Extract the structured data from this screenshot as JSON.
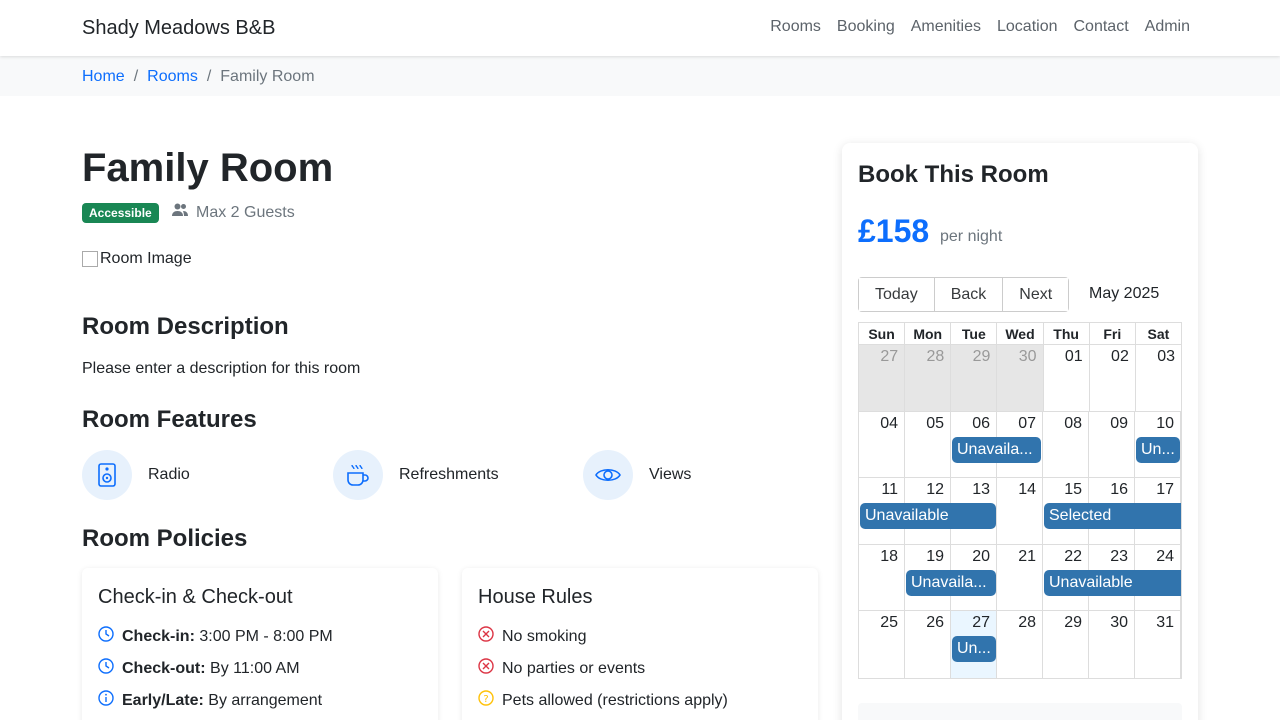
{
  "nav": {
    "brand": "Shady Meadows B&B",
    "links": [
      "Rooms",
      "Booking",
      "Amenities",
      "Location",
      "Contact",
      "Admin"
    ]
  },
  "breadcrumb": {
    "home": "Home",
    "rooms": "Rooms",
    "current": "Family Room"
  },
  "room": {
    "title": "Family Room",
    "badge": "Accessible",
    "guests": "Max 2 Guests",
    "image_alt": "Room Image",
    "description_heading": "Room Description",
    "description": "Please enter a description for this room",
    "features_heading": "Room Features",
    "features": [
      {
        "label": "Radio",
        "icon": "speaker-icon"
      },
      {
        "label": "Refreshments",
        "icon": "coffee-cup-icon"
      },
      {
        "label": "Views",
        "icon": "eye-icon"
      }
    ],
    "policies_heading": "Room Policies",
    "checkin_card": {
      "title": "Check-in & Check-out",
      "rows": [
        {
          "label": "Check-in:",
          "value": "3:00 PM - 8:00 PM"
        },
        {
          "label": "Check-out:",
          "value": "By 11:00 AM"
        },
        {
          "label": "Early/Late:",
          "value": "By arrangement"
        }
      ]
    },
    "rules_card": {
      "title": "House Rules",
      "rows": [
        "No smoking",
        "No parties or events",
        "Pets allowed (restrictions apply)"
      ]
    }
  },
  "booking": {
    "title": "Book This Room",
    "price": "£158",
    "per_night": "per night",
    "buttons": {
      "today": "Today",
      "back": "Back",
      "next": "Next"
    },
    "month": "May 2025",
    "weekdays": [
      "Sun",
      "Mon",
      "Tue",
      "Wed",
      "Thu",
      "Fri",
      "Sat"
    ],
    "weeks": [
      [
        "27",
        "28",
        "29",
        "30",
        "01",
        "02",
        "03"
      ],
      [
        "04",
        "05",
        "06",
        "07",
        "08",
        "09",
        "10"
      ],
      [
        "11",
        "12",
        "13",
        "14",
        "15",
        "16",
        "17"
      ],
      [
        "18",
        "19",
        "20",
        "21",
        "22",
        "23",
        "24"
      ],
      [
        "25",
        "26",
        "27",
        "28",
        "29",
        "30",
        "31"
      ]
    ],
    "events": {
      "w2a": "Unavaila...",
      "w2b": "Un...",
      "w3a": "Unavailable",
      "w3b": "Selected",
      "w4a": "Unavaila...",
      "w4b": "Unavailable",
      "w5a": "Un..."
    },
    "colors": {
      "event": "#3174ad",
      "price": "#0d6efd",
      "badge": "#198754"
    }
  }
}
